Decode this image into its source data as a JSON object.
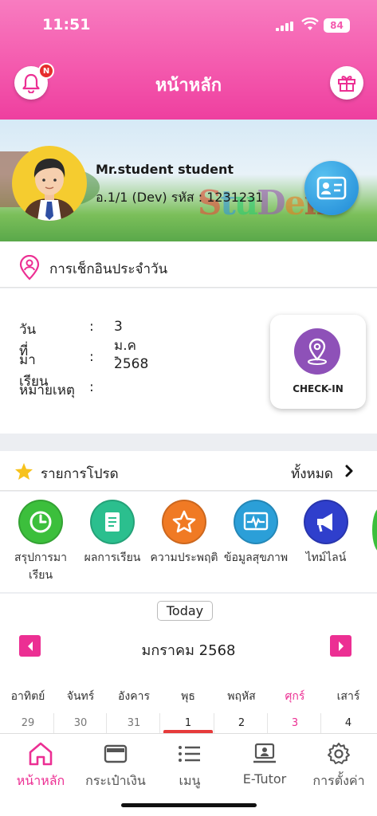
{
  "status_bar": {
    "time": "11:51",
    "battery": "84"
  },
  "header": {
    "title": "หน้าหลัก",
    "notification_badge": "N"
  },
  "profile": {
    "name": "Mr.student student",
    "class_line": "อ.1/1 (Dev) รหัส : 1231231",
    "watermark": [
      "S",
      "t",
      "u",
      "D",
      "e",
      "n",
      "t"
    ]
  },
  "checkin_section": {
    "title": "การเช็กอินประจำวัน",
    "rows": [
      {
        "label": "วันที่",
        "sep": ":",
        "value": "3 ม.ค 2568"
      },
      {
        "label": "มาเรียน",
        "sep": ":",
        "value": "-"
      },
      {
        "label": "หมายเหตุ",
        "sep": ":",
        "value": ""
      }
    ],
    "button_label": "CHECK-IN"
  },
  "favorites": {
    "title": "รายการโปรด",
    "see_all": "ทั้งหมด",
    "items": [
      {
        "label": "สรุปการมาเรียน",
        "icon": "clock-icon",
        "color": "#3cbf3c"
      },
      {
        "label": "ผลการเรียน",
        "icon": "report-icon",
        "color": "#2bbf8e"
      },
      {
        "label": "ความประพฤติ",
        "icon": "star-badge-icon",
        "color": "#f07a24"
      },
      {
        "label": "ข้อมูลสุขภาพ",
        "icon": "heart-monitor-icon",
        "color": "#2b9fd8"
      },
      {
        "label": "ไทม์ไลน์",
        "icon": "megaphone-icon",
        "color": "#2f3fcc"
      }
    ]
  },
  "calendar": {
    "today_button": "Today",
    "month_label": "มกราคม 2568",
    "weekdays": [
      "อาทิตย์",
      "จันทร์",
      "อังคาร",
      "พุธ",
      "พฤหัส",
      "ศุกร์",
      "เสาร์"
    ],
    "days": [
      "29",
      "30",
      "31",
      "1",
      "2",
      "3",
      "4"
    ],
    "highlight_weekday_index": 5,
    "today_index": 3,
    "accent": "#ec2f93"
  },
  "tabbar": {
    "tabs": [
      {
        "label": "หน้าหลัก",
        "icon": "home-icon",
        "active": true
      },
      {
        "label": "กระเป๋าเงิน",
        "icon": "wallet-icon",
        "active": false
      },
      {
        "label": "เมนู",
        "icon": "list-icon",
        "active": false
      },
      {
        "label": "E-Tutor",
        "icon": "tutor-icon",
        "active": false
      },
      {
        "label": "การตั้งค่า",
        "icon": "gear-icon",
        "active": false
      }
    ]
  }
}
